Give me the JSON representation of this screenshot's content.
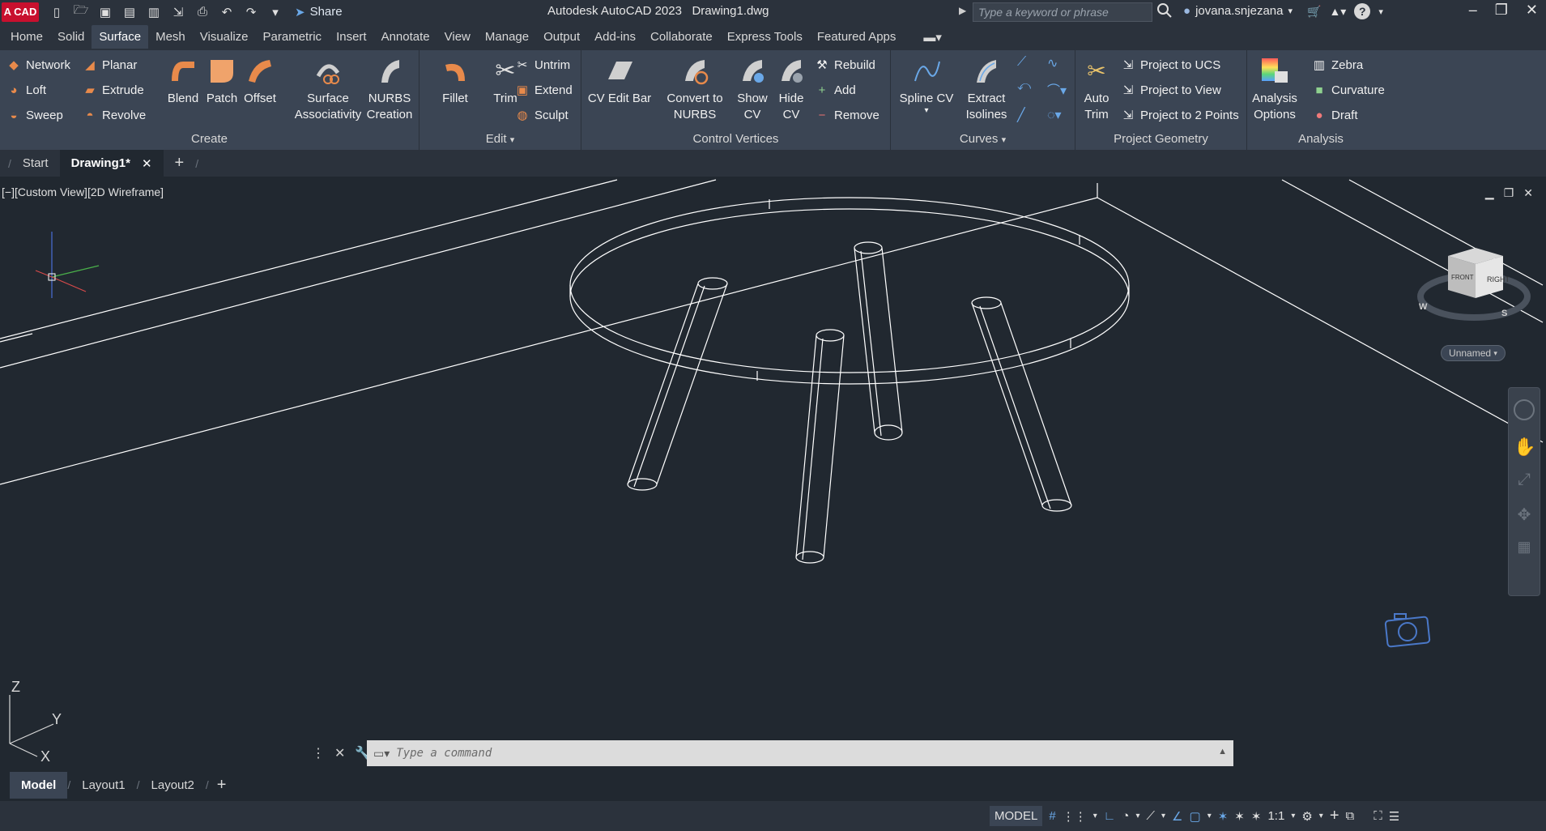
{
  "app": {
    "logo": "A CAD",
    "title": "Autodesk AutoCAD 2023",
    "document": "Drawing1.dwg",
    "share_label": "Share",
    "search_placeholder": "Type a keyword or phrase",
    "user": "jovana.snjezana"
  },
  "ribbon_tabs": [
    "Home",
    "Solid",
    "Surface",
    "Mesh",
    "Visualize",
    "Parametric",
    "Insert",
    "Annotate",
    "View",
    "Manage",
    "Output",
    "Add-ins",
    "Collaborate",
    "Express Tools",
    "Featured Apps"
  ],
  "active_ribbon_tab": "Surface",
  "ribbon": {
    "create": {
      "title": "Create",
      "network": "Network",
      "planar": "Planar",
      "loft": "Loft",
      "extrude": "Extrude",
      "sweep": "Sweep",
      "revolve": "Revolve",
      "blend": "Blend",
      "patch": "Patch",
      "offset": "Offset",
      "surface_assoc_1": "Surface",
      "surface_assoc_2": "Associativity",
      "nurbs_1": "NURBS",
      "nurbs_2": "Creation"
    },
    "edit": {
      "title": "Edit",
      "fillet": "Fillet",
      "trim": "Trim",
      "untrim": "Untrim",
      "extend": "Extend",
      "sculpt": "Sculpt"
    },
    "control_vertices": {
      "title": "Control Vertices",
      "cv_edit_bar": "CV Edit Bar",
      "convert_1": "Convert to",
      "convert_2": "NURBS",
      "show_1": "Show",
      "show_2": "CV",
      "hide_1": "Hide",
      "hide_2": "CV",
      "rebuild": "Rebuild",
      "add": "Add",
      "remove": "Remove"
    },
    "curves": {
      "title": "Curves",
      "spline_cv": "Spline CV",
      "extract_1": "Extract",
      "extract_2": "Isolines"
    },
    "project_geometry": {
      "title": "Project Geometry",
      "auto_1": "Auto",
      "auto_2": "Trim",
      "to_ucs": "Project to UCS",
      "to_view": "Project to View",
      "to_2_points": "Project to 2 Points"
    },
    "analysis": {
      "title": "Analysis",
      "options_1": "Analysis",
      "options_2": "Options",
      "zebra": "Zebra",
      "curvature": "Curvature",
      "draft": "Draft"
    }
  },
  "file_tabs": {
    "start": "Start",
    "drawing": "Drawing1*"
  },
  "viewport": {
    "label": "[−][Custom View][2D Wireframe]",
    "unnamed": "Unnamed",
    "viewcube_right": "RIGHT",
    "viewcube_front": "FRONT",
    "compass_s": "S",
    "compass_w": "W",
    "ucs_z": "Z",
    "ucs_y": "Y",
    "ucs_x": "X"
  },
  "command": {
    "placeholder": "Type a command"
  },
  "layout_tabs": [
    "Model",
    "Layout1",
    "Layout2"
  ],
  "status": {
    "model": "MODEL",
    "scale": "1:1"
  },
  "colors": {
    "background": "#212830",
    "ribbon": "#3b4554",
    "titlebar": "#2b323c",
    "accent": "#e88a4b"
  }
}
